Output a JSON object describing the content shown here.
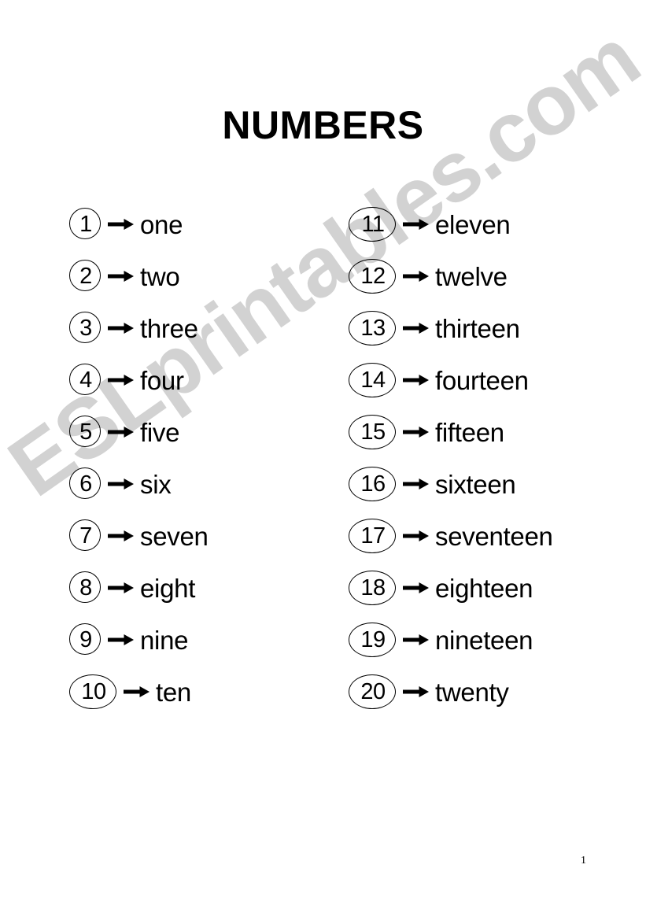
{
  "document": {
    "title": "NUMBERS",
    "page_number": "1",
    "watermark": "ESLprintables.com",
    "watermark_color": "#d2d2d2",
    "background_color": "#ffffff",
    "text_color": "#000000",
    "arrow_glyph": "right-arrow"
  },
  "columns": {
    "left": [
      {
        "number": "1",
        "arrow": "→",
        "word": "one"
      },
      {
        "number": "2",
        "arrow": "→",
        "word": "two"
      },
      {
        "number": "3",
        "arrow": "→",
        "word": "three"
      },
      {
        "number": "4",
        "arrow": "→",
        "word": "four"
      },
      {
        "number": "5",
        "arrow": "→",
        "word": "five"
      },
      {
        "number": "6",
        "arrow": "→",
        "word": "six"
      },
      {
        "number": "7",
        "arrow": "→",
        "word": "seven"
      },
      {
        "number": "8",
        "arrow": "→",
        "word": "eight"
      },
      {
        "number": "9",
        "arrow": "→",
        "word": "nine"
      },
      {
        "number": "10",
        "arrow": "→",
        "word": "ten"
      }
    ],
    "right": [
      {
        "number": "11",
        "arrow": "→",
        "word": "eleven"
      },
      {
        "number": "12",
        "arrow": "→",
        "word": "twelve"
      },
      {
        "number": "13",
        "arrow": "→",
        "word": "thirteen"
      },
      {
        "number": "14",
        "arrow": "→",
        "word": "fourteen"
      },
      {
        "number": "15",
        "arrow": "→",
        "word": "fifteen"
      },
      {
        "number": "16",
        "arrow": "→",
        "word": "sixteen"
      },
      {
        "number": "17",
        "arrow": "→",
        "word": "seventeen"
      },
      {
        "number": "18",
        "arrow": "→",
        "word": "eighteen"
      },
      {
        "number": "19",
        "arrow": "→",
        "word": "nineteen"
      },
      {
        "number": "20",
        "arrow": "→",
        "word": "twenty"
      }
    ]
  }
}
